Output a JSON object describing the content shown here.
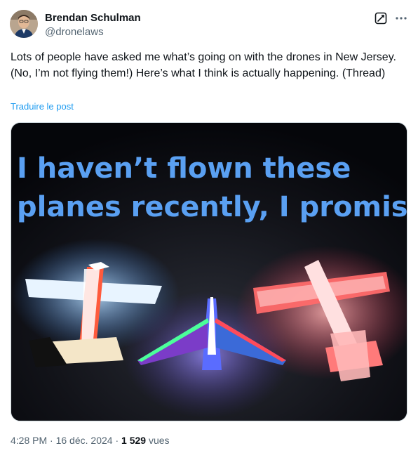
{
  "author": {
    "name": "Brendan Schulman",
    "handle": "@dronelaws"
  },
  "icons": {
    "grok": "grok-icon",
    "more": "more-options-icon"
  },
  "tweet": {
    "text": "Lots of people have asked me what’s going on with the drones in New Jersey. (No, I’m not flying them!) Here’s what I think is actually happening. (Thread)",
    "translate_label": "Traduire le post"
  },
  "media": {
    "caption_line1": "I haven’t flown these",
    "caption_line2": "planes recently, I promise.",
    "caption_color": "#5aa0f2"
  },
  "meta": {
    "time": "4:28 PM",
    "separator1": " · ",
    "date": "16 déc. 2024",
    "separator2": " · ",
    "views_count": "1 529",
    "views_label": " vues"
  }
}
